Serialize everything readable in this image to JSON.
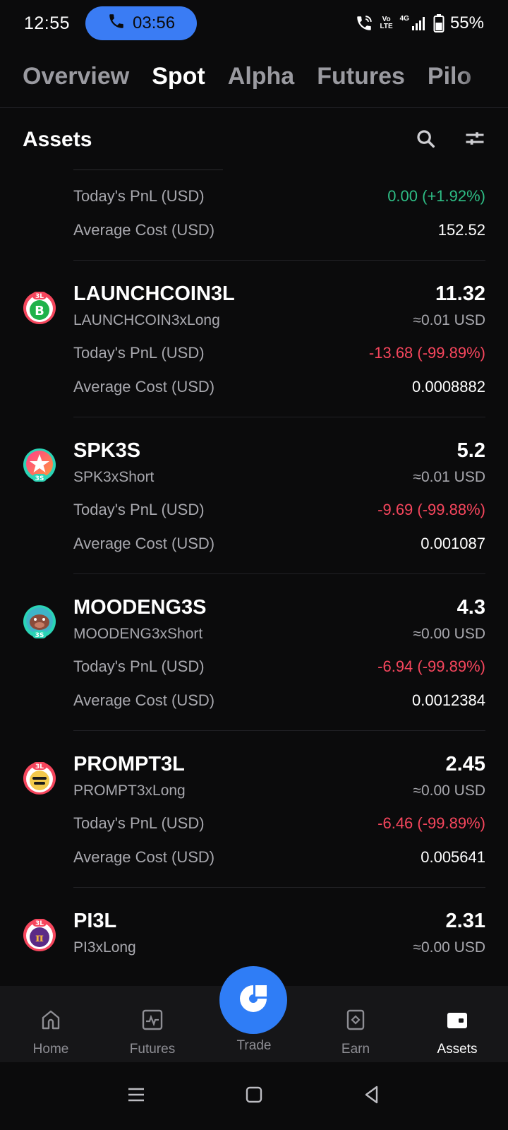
{
  "status_bar": {
    "time": "12:55",
    "call_timer": "03:56",
    "volte": "Vo LTE",
    "network": "4G",
    "battery": "55%"
  },
  "top_tabs": [
    "Overview",
    "Spot",
    "Alpha",
    "Futures",
    "Pilo"
  ],
  "active_tab": "Spot",
  "assets_header": {
    "title": "Assets"
  },
  "partial_asset": {
    "pnl_label": "Today's PnL (USD)",
    "pnl_value": "0.00 (+1.92%)",
    "cost_label": "Average Cost (USD)",
    "cost_value": "152.52"
  },
  "assets": [
    {
      "symbol": "LAUNCHCOIN3L",
      "name": "LAUNCHCOIN3xLong",
      "amount": "11.32",
      "usd": "≈0.01 USD",
      "pnl_label": "Today's PnL (USD)",
      "pnl_value": "-13.68 (-99.89%)",
      "cost_label": "Average Cost (USD)",
      "cost_value": "0.0008882",
      "badge": "3L",
      "icon": "launchcoin-logo-icon",
      "color": "#1fb24a",
      "ring": "#f6465d"
    },
    {
      "symbol": "SPK3S",
      "name": "SPK3xShort",
      "amount": "5.2",
      "usd": "≈0.01 USD",
      "pnl_label": "Today's PnL (USD)",
      "pnl_value": "-9.69 (-99.88%)",
      "cost_label": "Average Cost (USD)",
      "cost_value": "0.001087",
      "badge": "3S",
      "icon": "spk-star-logo-icon",
      "color": "#ff4d8d",
      "ring": "#2ad4b6"
    },
    {
      "symbol": "MOODENG3S",
      "name": "MOODENG3xShort",
      "amount": "4.3",
      "usd": "≈0.00 USD",
      "pnl_label": "Today's PnL (USD)",
      "pnl_value": "-6.94 (-99.89%)",
      "cost_label": "Average Cost (USD)",
      "cost_value": "0.0012384",
      "badge": "3S",
      "icon": "moodeng-hippo-logo-icon",
      "color": "#8b4b3a",
      "ring": "#2ad4b6"
    },
    {
      "symbol": "PROMPT3L",
      "name": "PROMPT3xLong",
      "amount": "2.45",
      "usd": "≈0.00 USD",
      "pnl_label": "Today's PnL (USD)",
      "pnl_value": "-6.46 (-99.89%)",
      "cost_label": "Average Cost (USD)",
      "cost_value": "0.005641",
      "badge": "3L",
      "icon": "prompt-logo-icon",
      "color": "#f2c94c",
      "ring": "#f6465d"
    },
    {
      "symbol": "PI3L",
      "name": "PI3xLong",
      "amount": "2.31",
      "usd": "≈0.00 USD",
      "badge": "3L",
      "icon": "pi-logo-icon",
      "color": "#5b2a86",
      "ring": "#f6465d"
    }
  ],
  "bottom_nav": [
    {
      "label": "Home",
      "icon": "home-icon"
    },
    {
      "label": "Futures",
      "icon": "futures-chart-icon"
    },
    {
      "label": "Trade",
      "icon": "trade-icon"
    },
    {
      "label": "Earn",
      "icon": "earn-icon"
    },
    {
      "label": "Assets",
      "icon": "wallet-icon"
    }
  ],
  "active_nav": "Assets",
  "colors": {
    "positive": "#2ebd85",
    "negative": "#f6465d",
    "accent": "#2f7df6",
    "background": "#0b0b0c"
  }
}
